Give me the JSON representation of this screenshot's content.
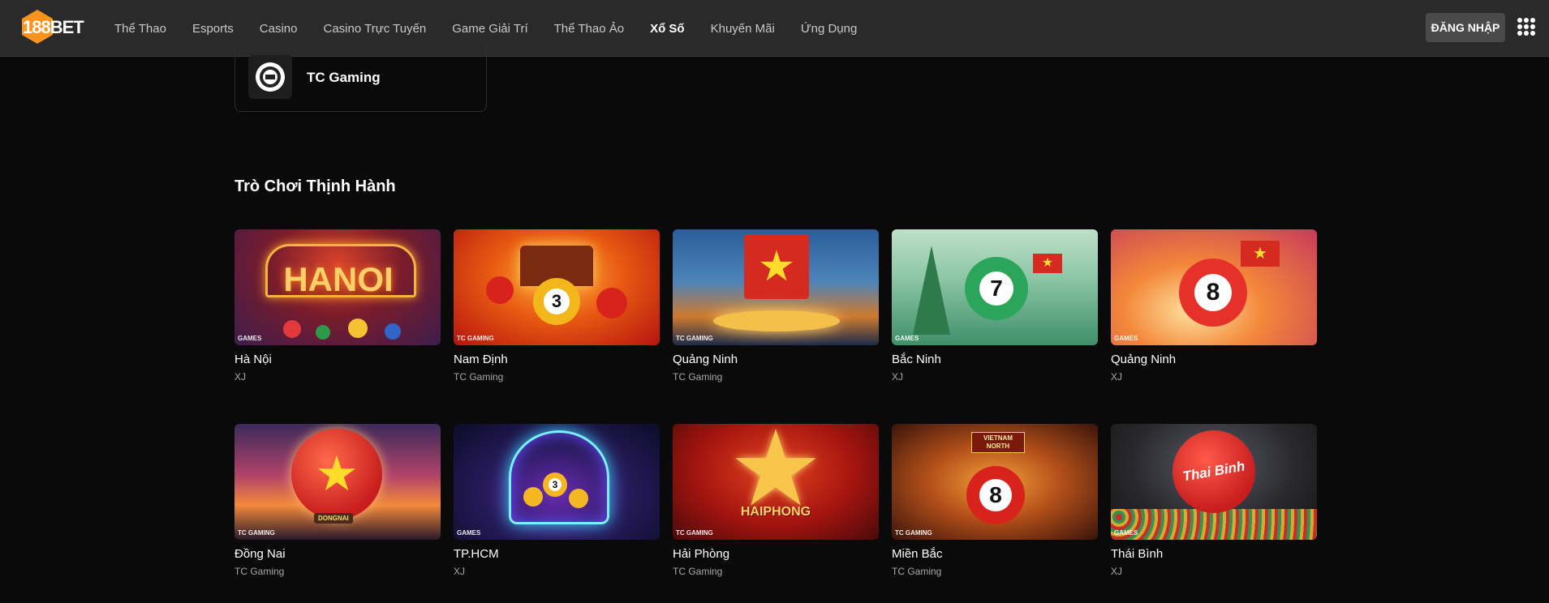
{
  "header": {
    "logo_text": "188BET",
    "nav": [
      {
        "label": "Thể Thao"
      },
      {
        "label": "Esports"
      },
      {
        "label": "Casino"
      },
      {
        "label": "Casino Trực Tuyến"
      },
      {
        "label": "Game Giải Trí"
      },
      {
        "label": "Thể Thao Ảo"
      },
      {
        "label": "Xổ Số",
        "active": true
      },
      {
        "label": "Khuyến Mãi"
      },
      {
        "label": "Ứng Dụng"
      }
    ],
    "login_label": "ĐĂNG NHẬP",
    "menu_icon": "apps-grid-icon"
  },
  "provider": {
    "name": "TC Gaming",
    "icon": "poker-chip-icon"
  },
  "section": {
    "title": "Trò Chơi Thịnh Hành"
  },
  "games": [
    {
      "name": "Hà Nội",
      "provider": "XJ",
      "thumb_text": "HANOI",
      "badge": "GAMES"
    },
    {
      "name": "Nam Định",
      "provider": "TC Gaming",
      "thumb_text": "3",
      "badge": "TC GAMING"
    },
    {
      "name": "Quảng Ninh",
      "provider": "TC Gaming",
      "thumb_text": "",
      "badge": "TC GAMING"
    },
    {
      "name": "Bắc Ninh",
      "provider": "XJ",
      "thumb_text": "7",
      "badge": "GAMES"
    },
    {
      "name": "Quảng Ninh",
      "provider": "XJ",
      "thumb_text": "8",
      "badge": "GAMES"
    },
    {
      "name": "Đồng Nai",
      "provider": "TC Gaming",
      "thumb_text": "DONGNAI",
      "badge": "TC GAMING"
    },
    {
      "name": "TP.HCM",
      "provider": "XJ",
      "thumb_text": "3",
      "badge": "GAMES"
    },
    {
      "name": "Hải Phòng",
      "provider": "TC Gaming",
      "thumb_text": "HAIPHONG",
      "badge": "TC GAMING"
    },
    {
      "name": "Miền Bắc",
      "provider": "TC Gaming",
      "thumb_text": "8",
      "sign_text": "VIETNAM NORTH",
      "badge": "TC GAMING"
    },
    {
      "name": "Thái Bình",
      "provider": "XJ",
      "thumb_text": "Thai Binh",
      "badge": "GAMES"
    }
  ],
  "colors": {
    "background": "#0a0a0a",
    "header": "#2a2a2a",
    "logo_orange": "#f7941d",
    "muted_text": "#a7a7a7"
  }
}
